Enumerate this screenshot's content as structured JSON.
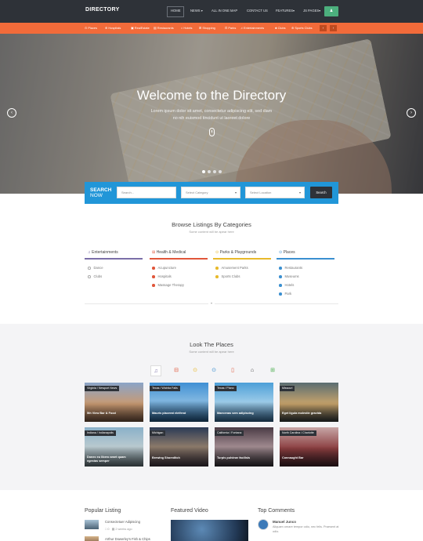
{
  "header": {
    "logo": "DIRECTORY",
    "nav": [
      {
        "label": "HOME",
        "x": 0
      },
      {
        "label": "NEWS ▾"
      },
      {
        "label": "ALL IN ONE MAP"
      },
      {
        "label": "CONTACT US"
      },
      {
        "label": "FEATURES▾"
      },
      {
        "label": "JS PAGES▾"
      }
    ],
    "user_icon": "user-icon"
  },
  "category_bar": {
    "items": [
      "⊙ Places",
      "⊕ Hospitals",
      "▣ RealEstate",
      "▤ Restaurants",
      "⌂ Hotels",
      "⊞ Shopping",
      "⊡ Parks",
      "♫ Entertainments",
      "♣ Clubs",
      "⊛ Sports Clubs"
    ],
    "prev": "‹",
    "next": "›"
  },
  "hero": {
    "title": "Welcome to the Directory",
    "subtitle": "Lorem ipsum dolor sit amet, consectetur adipiscing elit, sed diam no nih euismod tincidunt ut laoreet dolore",
    "prev": "‹",
    "next": "›"
  },
  "search": {
    "label_top": "SEARCH",
    "label_bottom": "NOW",
    "placeholder": "Search...",
    "category": "Select Category",
    "location": "Select Location",
    "button": "Search"
  },
  "browse": {
    "title": "Browse Listings By Categories",
    "subtitle": "Some content will be apear here",
    "columns": [
      {
        "icon": "music-icon",
        "glyph": "♫",
        "title": "Entertainments",
        "color": "#7b6fa8",
        "items": [
          "Dance",
          "Clubs"
        ]
      },
      {
        "icon": "briefcase-icon",
        "glyph": "⊞",
        "title": "Health & Medical",
        "color": "#e0563a",
        "items": [
          "Acupuncture",
          "Hospitals",
          "Massage Therapy"
        ]
      },
      {
        "icon": "map-pin-icon",
        "glyph": "⊙",
        "title": "Parks & Playgrounds",
        "color": "#e8b92b",
        "items": [
          "Amusement Parks",
          "Sports Clubs"
        ]
      },
      {
        "icon": "location-icon",
        "glyph": "⊙",
        "title": "Places",
        "color": "#3a8fd0",
        "items": [
          "Restaurants",
          "Museums",
          "Hotels",
          "Park"
        ]
      }
    ]
  },
  "places": {
    "title": "Look The Places",
    "subtitle": "Some content will be apear here",
    "tabs": [
      {
        "glyph": "♫",
        "icon": "music-icon",
        "color": "#7b6fa8"
      },
      {
        "glyph": "⊟",
        "icon": "car-icon",
        "color": "#e0563a"
      },
      {
        "glyph": "⊙",
        "icon": "pin-icon",
        "color": "#e8b92b"
      },
      {
        "glyph": "⊙",
        "icon": "location-icon",
        "color": "#3a8fd0"
      },
      {
        "glyph": "▯",
        "icon": "phone-icon",
        "color": "#e0563a"
      },
      {
        "glyph": "⌂",
        "icon": "graduation-icon",
        "color": "#333333"
      },
      {
        "glyph": "⊞",
        "icon": "cart-icon",
        "color": "#4caf50"
      }
    ],
    "cards": [
      {
        "loc": "Virginia / Newport News",
        "cap": "5th View Bar & Food",
        "bg": "linear-gradient(#8aa4c8,#c99a72 55%,#6b4d3a)"
      },
      {
        "loc": "Texas / Wichita Falls",
        "cap": "Mauris placerat eleifend",
        "bg": "linear-gradient(#3f8fd4,#7fb6e0 45%,#1e4f7a)"
      },
      {
        "loc": "Texas / Plano",
        "cap": "Maecenas sem adipiscing",
        "bg": "linear-gradient(#4c9fd8,#9ccbe8 50%,#2d5e86)"
      },
      {
        "loc": "Missouri",
        "cap": "Eget ligula molestie gravida",
        "bg": "linear-gradient(#5a6d72,#c8a46b 55%,#2f3535)"
      },
      {
        "loc": "Indiana / Indianapolis",
        "cap": "Donec eu libero amet quam egestas semper",
        "bg": "linear-gradient(#8ab0c9,#b9c9cf 50%,#5b6a70)"
      },
      {
        "loc": "Michigan",
        "cap": "Brewing Shoreditch",
        "bg": "linear-gradient(#2b3b55,#8c7a6a 50%,#3a2f3a)"
      },
      {
        "loc": "California / Fontana",
        "cap": "Turpis pulvinar facilisis",
        "bg": "linear-gradient(#4a3b45,#a08a8f 50%,#2e2a30)"
      },
      {
        "loc": "North Carolina / Charlotte",
        "cap": "Connaught Bar",
        "bg": "linear-gradient(#c7a6a6,#8a3d3f 55%,#3a1f25)"
      }
    ]
  },
  "bottom": {
    "popular_title": "Popular Listing",
    "popular": [
      {
        "title": "Consectetuer Adipiscing",
        "comments": "0",
        "time": "2 weeks ago"
      },
      {
        "title": "Arthur Dowerley's Fish & Chips"
      }
    ],
    "video_title": "Featured Video",
    "comments_title": "Top Comments",
    "comment": {
      "name": "Manuel Junco",
      "text": "Aliquam ornare tempor odio, nec felis. Praesent at odio."
    }
  }
}
